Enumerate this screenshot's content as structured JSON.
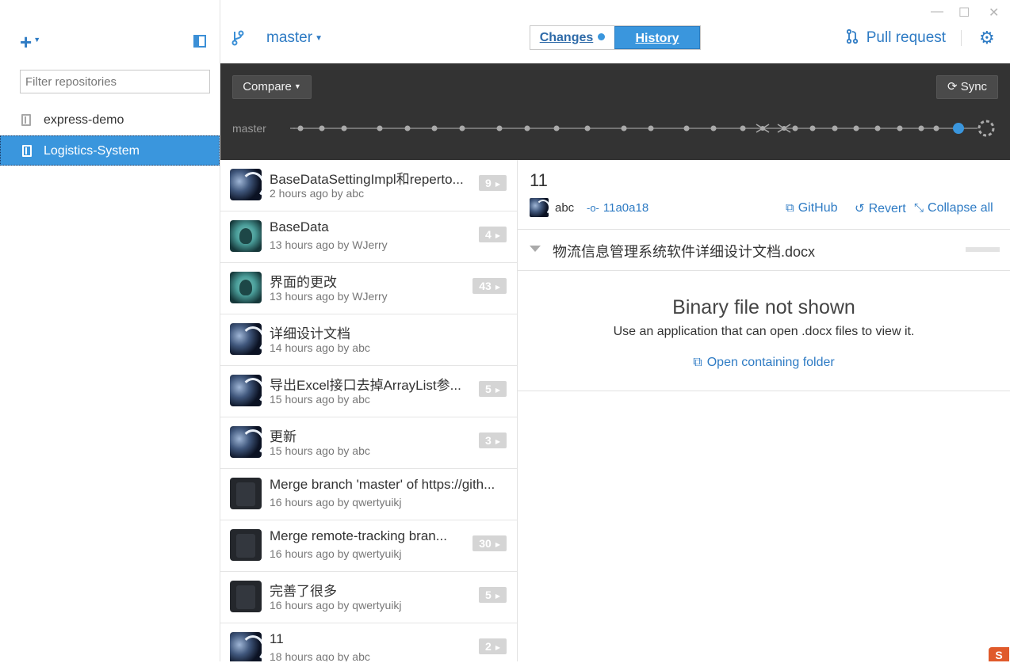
{
  "window": {
    "minimize": "—",
    "maximize": "☐",
    "close": "✕"
  },
  "sidebar": {
    "add_label": "+",
    "filter_placeholder": "Filter repositories",
    "repos": [
      {
        "name": "express-demo",
        "selected": false
      },
      {
        "name": "Logistics-System",
        "selected": true
      }
    ]
  },
  "header": {
    "branch": "master",
    "tabs": {
      "changes": "Changes",
      "history": "History",
      "active": "History"
    },
    "pull_request": "Pull request"
  },
  "timeline": {
    "compare_label": "Compare",
    "sync_label": "Sync",
    "branch_label": "master"
  },
  "commits": [
    {
      "title": "BaseDataSettingImpl和reperto...",
      "meta": "2 hours ago by abc",
      "files": "9",
      "avatar": "abc"
    },
    {
      "title": "BaseData",
      "meta": "13 hours ago by WJerry",
      "files": "4",
      "avatar": "wjerry"
    },
    {
      "title": "界面的更改",
      "meta": "13 hours ago by WJerry",
      "files": "43",
      "avatar": "wjerry"
    },
    {
      "title": "详细设计文档",
      "meta": "14 hours ago by abc",
      "files": "",
      "avatar": "abc"
    },
    {
      "title": "导出Excel接口去掉ArrayList参...",
      "meta": "15 hours ago by abc",
      "files": "5",
      "avatar": "abc"
    },
    {
      "title": "更新",
      "meta": "15 hours ago by abc",
      "files": "3",
      "avatar": "abc"
    },
    {
      "title": "Merge branch 'master' of https://gith...",
      "meta": "16 hours ago by qwertyuikj",
      "files": "",
      "avatar": "qwertyuikj"
    },
    {
      "title": "Merge remote-tracking bran...",
      "meta": "16 hours ago by qwertyuikj",
      "files": "30",
      "avatar": "qwertyuikj"
    },
    {
      "title": "完善了很多",
      "meta": "16 hours ago by qwertyuikj",
      "files": "5",
      "avatar": "qwertyuikj"
    },
    {
      "title": "11",
      "meta": "18 hours ago by abc",
      "files": "2",
      "avatar": "abc"
    }
  ],
  "details": {
    "title": "11",
    "author": "abc",
    "sha": "11a0a18",
    "github": "GitHub",
    "revert": "Revert",
    "collapse": "Collapse all",
    "file_name": "物流信息管理系统软件详细设计文档.docx",
    "binary_title": "Binary file not shown",
    "binary_sub": "Use an application that can open .docx files to view it.",
    "open_folder": "Open containing folder"
  },
  "colors": {
    "accent": "#3a96dd",
    "link": "#2e7bc4",
    "timeline_bg": "#333333"
  }
}
